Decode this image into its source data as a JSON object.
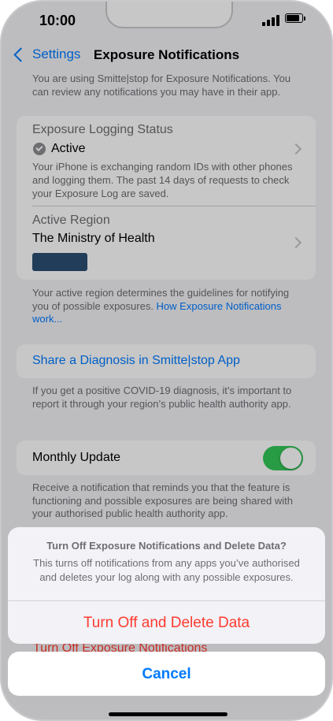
{
  "status_bar": {
    "time": "10:00"
  },
  "nav": {
    "back_label": "Settings",
    "title": "Exposure Notifications"
  },
  "intro_text": "You are using Smitte|stop for Exposure Notifications. You can review any notifications you may have in their app.",
  "status_section": {
    "header": "Exposure Logging Status",
    "status": "Active",
    "description": "Your iPhone is exchanging random IDs with other phones and logging them. The past 14 days of requests to check your Exposure Log are saved.",
    "region_header": "Active Region",
    "region_value": "The Ministry of Health",
    "region_badge_color": "#2b4f73"
  },
  "region_footer": {
    "text": "Your active region determines the guidelines for notifying you of possible exposures. ",
    "link": "How Exposure Notifications work..."
  },
  "share": {
    "label": "Share a Diagnosis in Smitte|stop App",
    "footer": "If you get a positive COVID-19 diagnosis, it’s important to report it through your region’s public health authority app."
  },
  "monthly": {
    "label": "Monthly Update",
    "enabled": true,
    "footer": "Receive a notification that reminds you that the feature is functioning and possible exposures are being shared with your authorised public health authority app."
  },
  "background_peek": "Turn Off Exposure Notifications",
  "action_sheet": {
    "title": "Turn Off Exposure Notifications and Delete Data?",
    "message": "This turns off notifications from any apps you’ve authorised and deletes your log along with any possible exposures.",
    "destructive": "Turn Off and Delete Data",
    "cancel": "Cancel"
  },
  "colors": {
    "accent": "#007aff",
    "destructive": "#ff3b30",
    "toggle_on": "#34c759"
  }
}
